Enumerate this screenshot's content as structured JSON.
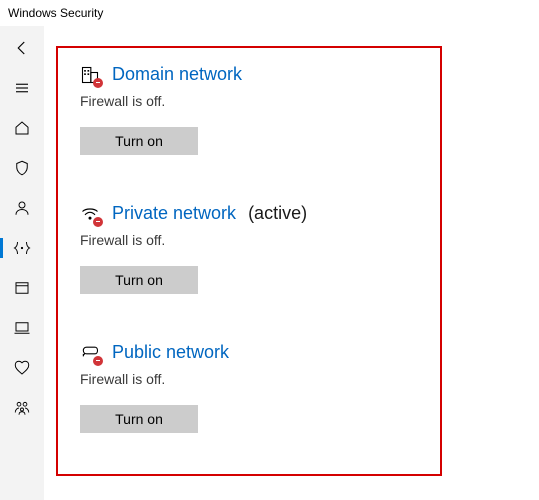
{
  "window": {
    "title": "Windows Security"
  },
  "sidebar": {
    "items": [
      {
        "name": "back"
      },
      {
        "name": "menu"
      },
      {
        "name": "home"
      },
      {
        "name": "protection"
      },
      {
        "name": "account"
      },
      {
        "name": "firewall"
      },
      {
        "name": "app-browser"
      },
      {
        "name": "device"
      },
      {
        "name": "health"
      },
      {
        "name": "family"
      }
    ]
  },
  "networks": [
    {
      "icon": "domain",
      "title": "Domain network",
      "active": false,
      "active_label": "",
      "status": "Firewall is off.",
      "button": "Turn on"
    },
    {
      "icon": "private",
      "title": "Private network",
      "active": true,
      "active_label": "(active)",
      "status": "Firewall is off.",
      "button": "Turn on"
    },
    {
      "icon": "public",
      "title": "Public network",
      "active": false,
      "active_label": "",
      "status": "Firewall is off.",
      "button": "Turn on"
    }
  ]
}
